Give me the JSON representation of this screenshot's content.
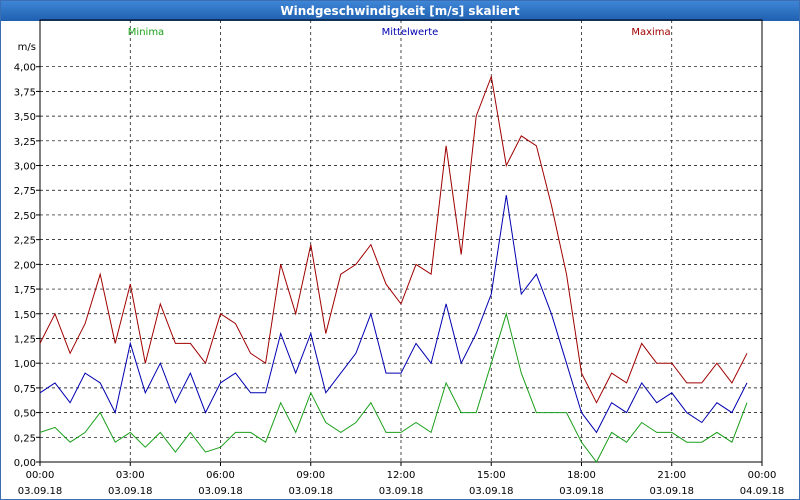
{
  "window": {
    "title": "Windgeschwindigkeit [m/s] skaliert"
  },
  "colors": {
    "minima": "#1a9f1a",
    "mittel": "#0000b0",
    "maxima": "#a00000"
  },
  "chart_data": {
    "type": "line",
    "title": "Windgeschwindigkeit [m/s] skaliert",
    "ylabel": "m/s",
    "ylim": [
      0,
      4.25
    ],
    "grid": true,
    "legend_placement": "top",
    "yticks": [
      "0,00",
      "0,25",
      "0,50",
      "0,75",
      "1,00",
      "1,25",
      "1,50",
      "1,75",
      "2,00",
      "2,25",
      "2,50",
      "2,75",
      "3,00",
      "3,25",
      "3,50",
      "3,75",
      "4,00"
    ],
    "xticks": [
      {
        "time": "00:00",
        "date": "03.09.18"
      },
      {
        "time": "03:00",
        "date": "03.09.18"
      },
      {
        "time": "06:00",
        "date": "03.09.18"
      },
      {
        "time": "09:00",
        "date": "03.09.18"
      },
      {
        "time": "12:00",
        "date": "03.09.18"
      },
      {
        "time": "15:00",
        "date": "03.09.18"
      },
      {
        "time": "18:00",
        "date": "03.09.18"
      },
      {
        "time": "21:00",
        "date": "03.09.18"
      },
      {
        "time": "00:00",
        "date": "04.09.18"
      }
    ],
    "x_hours": [
      0,
      0.5,
      1,
      1.5,
      2,
      2.5,
      3,
      3.5,
      4,
      4.5,
      5,
      5.5,
      6,
      6.5,
      7,
      7.5,
      8,
      8.5,
      9,
      9.5,
      10,
      10.5,
      11,
      11.5,
      12,
      12.5,
      13,
      13.5,
      14,
      14.5,
      15,
      15.5,
      16,
      16.5,
      17,
      17.5,
      18,
      18.5,
      19,
      19.5,
      20,
      20.5,
      21,
      21.5,
      22,
      22.5,
      23,
      23.5
    ],
    "series": [
      {
        "name": "Minima",
        "values": [
          0.3,
          0.35,
          0.2,
          0.3,
          0.5,
          0.2,
          0.3,
          0.15,
          0.3,
          0.1,
          0.3,
          0.1,
          0.15,
          0.3,
          0.3,
          0.2,
          0.6,
          0.3,
          0.7,
          0.4,
          0.3,
          0.4,
          0.6,
          0.3,
          0.3,
          0.4,
          0.3,
          0.8,
          0.5,
          0.5,
          1.0,
          1.5,
          0.9,
          0.5,
          0.5,
          0.5,
          0.2,
          0.0,
          0.3,
          0.2,
          0.4,
          0.3,
          0.3,
          0.2,
          0.2,
          0.3,
          0.2,
          0.6
        ]
      },
      {
        "name": "Mittelwerte",
        "values": [
          0.7,
          0.8,
          0.6,
          0.9,
          0.8,
          0.5,
          1.2,
          0.7,
          1.0,
          0.6,
          0.9,
          0.5,
          0.8,
          0.9,
          0.7,
          0.7,
          1.3,
          0.9,
          1.3,
          0.7,
          0.9,
          1.1,
          1.5,
          0.9,
          0.9,
          1.2,
          1.0,
          1.6,
          1.0,
          1.3,
          1.7,
          2.7,
          1.7,
          1.9,
          1.5,
          1.0,
          0.5,
          0.3,
          0.6,
          0.5,
          0.8,
          0.6,
          0.7,
          0.5,
          0.4,
          0.6,
          0.5,
          0.8
        ]
      },
      {
        "name": "Maxima",
        "values": [
          1.2,
          1.5,
          1.1,
          1.4,
          1.9,
          1.2,
          1.8,
          1.0,
          1.6,
          1.2,
          1.2,
          1.0,
          1.5,
          1.4,
          1.1,
          1.0,
          2.0,
          1.5,
          2.2,
          1.3,
          1.9,
          2.0,
          2.2,
          1.8,
          1.6,
          2.0,
          1.9,
          3.2,
          2.1,
          3.5,
          3.9,
          3.0,
          3.3,
          3.2,
          2.6,
          1.9,
          0.9,
          0.6,
          0.9,
          0.8,
          1.2,
          1.0,
          1.0,
          0.8,
          0.8,
          1.0,
          0.8,
          1.1
        ]
      }
    ]
  }
}
